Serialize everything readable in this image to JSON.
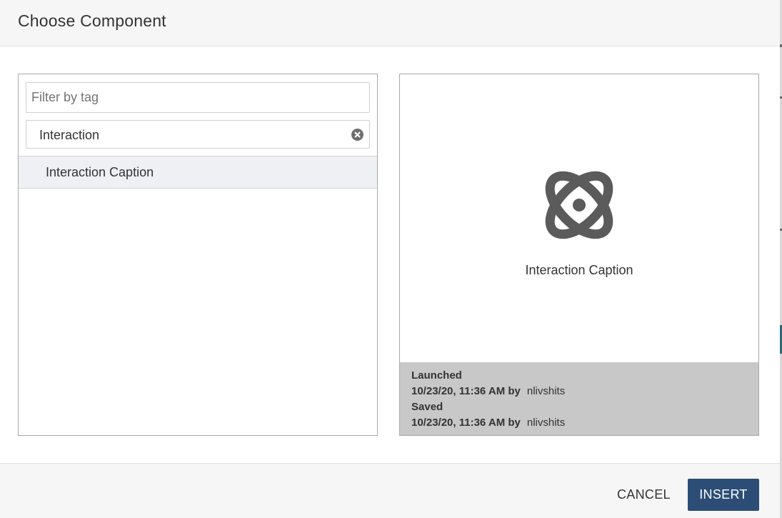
{
  "dialog": {
    "title": "Choose Component"
  },
  "left_panel": {
    "filter_placeholder": "Filter by tag",
    "filter_value": "",
    "search_value": "Interaction",
    "results": [
      {
        "label": "Interaction Caption",
        "selected": true
      }
    ]
  },
  "preview": {
    "icon": "atom-icon",
    "label": "Interaction Caption",
    "launched_heading": "Launched",
    "launched_date": "10/23/20, 11:36 AM by",
    "launched_user": "nlivshits",
    "saved_heading": "Saved",
    "saved_date": "10/23/20, 11:36 AM by",
    "saved_user": "nlivshits"
  },
  "footer": {
    "cancel_label": "CANCEL",
    "insert_label": "INSERT"
  },
  "colors": {
    "primary": "#2c4e76",
    "selected_row": "#eff0f4",
    "meta_background": "#c8c8c8",
    "icon": "#5b5b5b"
  }
}
